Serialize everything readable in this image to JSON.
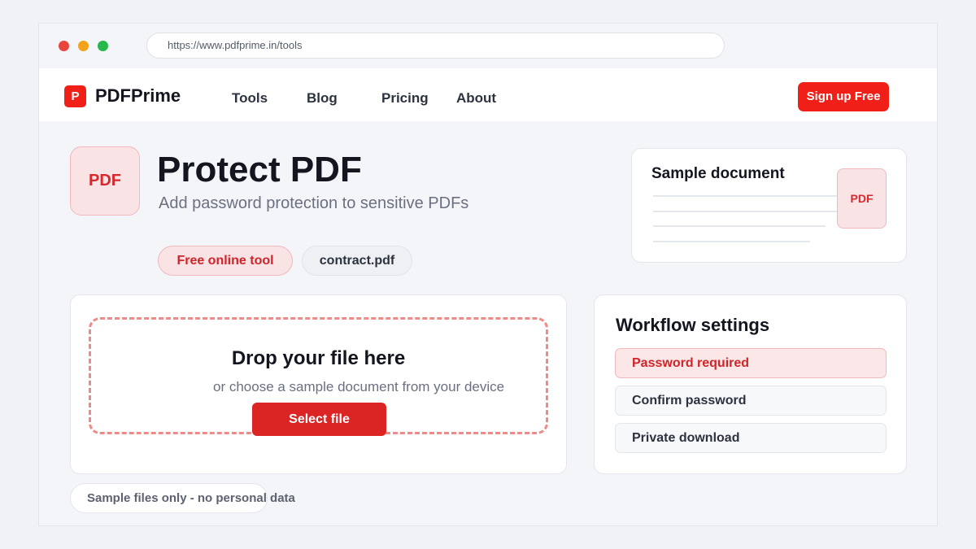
{
  "browser": {
    "url": "https://www.pdfprime.in/tools"
  },
  "nav": {
    "logo_letter": "P",
    "brand": "PDFPrime",
    "links": [
      "Tools",
      "Blog",
      "Pricing",
      "About"
    ],
    "signup_label": "Sign up Free"
  },
  "hero": {
    "icon_label": "PDF",
    "title": "Protect PDF",
    "subtitle": "Add password protection to sensitive PDFs",
    "chips": [
      "Free online tool",
      "contract.pdf"
    ]
  },
  "sample_card": {
    "title": "Sample document",
    "pdf_label": "PDF"
  },
  "upload": {
    "title": "Drop your file here",
    "subtitle": "or choose a sample document from your device",
    "button_label": "Select file"
  },
  "settings": {
    "title": "Workflow settings",
    "items": [
      "Password required",
      "Confirm password",
      "Private download"
    ],
    "active_index": 0
  },
  "footer": {
    "note": "Sample files only - no personal data"
  },
  "colors": {
    "brand_red": "#f01f17",
    "button_red": "#db2525",
    "accent_pink": "#f9e3e5"
  }
}
